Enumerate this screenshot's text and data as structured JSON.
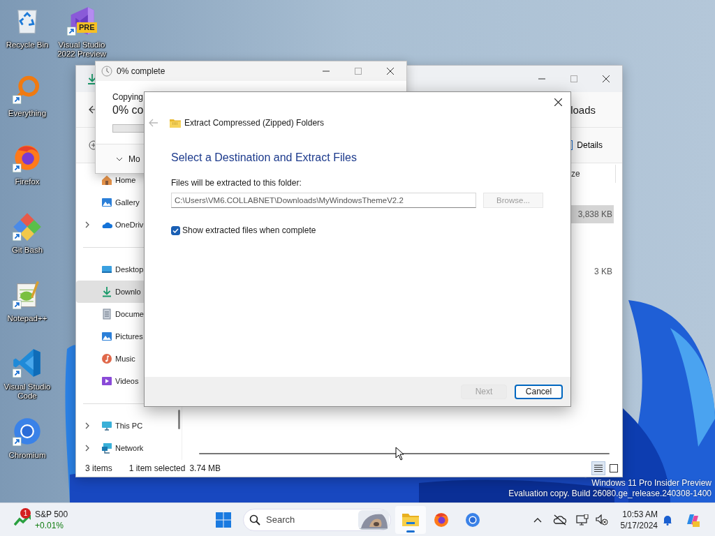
{
  "desktop_icons": [
    {
      "label": "Recycle Bin",
      "kind": "recycle-bin",
      "shortcut": false
    },
    {
      "label": "Visual Studio 2022 Preview",
      "kind": "vs-preview",
      "shortcut": true,
      "badge": "PRE"
    },
    {
      "label": "Everything",
      "kind": "everything",
      "shortcut": true
    },
    {
      "label": "Firefox",
      "kind": "firefox",
      "shortcut": true
    },
    {
      "label": "Git Bash",
      "kind": "git-bash",
      "shortcut": true
    },
    {
      "label": "Notepad++",
      "kind": "notepad",
      "shortcut": true
    },
    {
      "label": "Visual Studio Code",
      "kind": "vscode",
      "shortcut": true
    },
    {
      "label": "Chromium",
      "kind": "chromium",
      "shortcut": true
    }
  ],
  "explorer": {
    "location": "loads",
    "view_button": "Details",
    "column_header": "ze",
    "files": [
      {
        "size": "3,838 KB",
        "selected": true
      },
      {
        "size": "3 KB",
        "selected": false
      }
    ],
    "sidebar_groups": [
      [
        {
          "label": "Home",
          "kind": "home",
          "expandable": false,
          "selected": false
        },
        {
          "label": "Gallery",
          "kind": "gallery",
          "expandable": false,
          "selected": false
        },
        {
          "label": "OneDriv",
          "kind": "onedrive",
          "expandable": true,
          "selected": false
        }
      ],
      [
        {
          "label": "Desktop",
          "kind": "desktop",
          "expandable": false,
          "selected": false
        },
        {
          "label": "Downlo",
          "kind": "downloads",
          "expandable": false,
          "selected": true
        },
        {
          "label": "Docume",
          "kind": "documents",
          "expandable": false,
          "selected": false
        },
        {
          "label": "Pictures",
          "kind": "pictures",
          "expandable": false,
          "selected": false
        },
        {
          "label": "Music",
          "kind": "music",
          "expandable": false,
          "selected": false
        },
        {
          "label": "Videos",
          "kind": "videos",
          "expandable": false,
          "selected": false
        }
      ],
      [
        {
          "label": "This PC",
          "kind": "thispc",
          "expandable": true,
          "selected": false
        },
        {
          "label": "Network",
          "kind": "network",
          "expandable": true,
          "selected": false
        }
      ]
    ],
    "status": {
      "count": "3 items",
      "selection": "1 item selected",
      "size": "3.74 MB"
    },
    "views": [
      {
        "kind": "details",
        "selected": true
      },
      {
        "kind": "tiles",
        "selected": false
      }
    ]
  },
  "copy_dialog": {
    "title": "0% complete",
    "operation": "Copying",
    "progress_text": "0% co",
    "level": 0,
    "details_toggle": "Mo"
  },
  "extract_dialog": {
    "title": "Extract Compressed (Zipped) Folders",
    "heading": "Select a Destination and Extract Files",
    "field_label": "Files will be extracted to this folder:",
    "path": "C:\\Users\\VM6.COLLABNET\\Downloads\\MyWindowsThemeV2.2",
    "browse": {
      "label": "Browse...",
      "disabled": true
    },
    "show_files": {
      "label": "Show extracted files when complete",
      "checked": true
    },
    "buttons": [
      {
        "label": "Next",
        "disabled": true,
        "default": false
      },
      {
        "label": "Cancel",
        "disabled": false,
        "default": true
      }
    ]
  },
  "os_watermark": [
    "Windows 11 Pro Insider Preview",
    "Evaluation copy. Build 26080.ge_release.240308-1400"
  ],
  "taskbar": {
    "widget": {
      "badge": "1",
      "title": "S&P 500",
      "change": "+0.01%"
    },
    "search": {
      "placeholder": "Search"
    },
    "apps": [
      {
        "kind": "explorer",
        "active": true
      },
      {
        "kind": "firefox",
        "active": false
      },
      {
        "kind": "chromium",
        "active": false
      }
    ],
    "clock": {
      "time": "10:53 AM",
      "date": "5/17/2024"
    }
  }
}
